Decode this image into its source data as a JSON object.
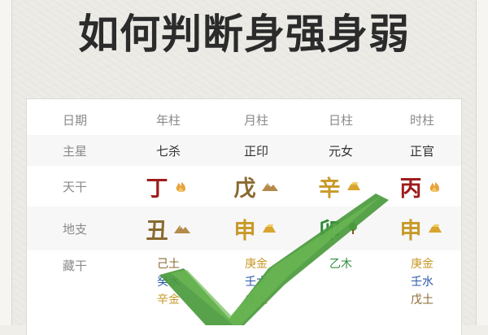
{
  "title": "如何判断身强身弱",
  "table": {
    "header": {
      "label": "日期",
      "cols": [
        "年柱",
        "月柱",
        "日柱",
        "时柱"
      ]
    },
    "main_star": {
      "label": "主星",
      "cols": [
        "七杀",
        "正印",
        "元女",
        "正官"
      ]
    },
    "heavenly_stems": {
      "label": "天干",
      "cols": [
        {
          "char": "丁",
          "color": "#9e1c1c",
          "icon": "fire-icon"
        },
        {
          "char": "戊",
          "color": "#8a6a2f",
          "icon": "mountain-icon"
        },
        {
          "char": "辛",
          "color": "#c89a2a",
          "icon": "gold-icon"
        },
        {
          "char": "丙",
          "color": "#9e1c1c",
          "icon": "fire-icon"
        }
      ]
    },
    "earthly_branches": {
      "label": "地支",
      "cols": [
        {
          "char": "丑",
          "color": "#8a6a2f",
          "icon": "mountain-icon"
        },
        {
          "char": "申",
          "color": "#c89a2a",
          "icon": "gold-icon"
        },
        {
          "char": "卯",
          "color": "#2e8b3a",
          "icon": "tree-icon"
        },
        {
          "char": "申",
          "color": "#c89a2a",
          "icon": "gold-icon"
        }
      ]
    },
    "hidden_stems": {
      "label": "藏干",
      "cols": [
        [
          {
            "text": "己土",
            "color": "#8a6a2f"
          },
          {
            "text": "癸水",
            "color": "#2b5aa8"
          },
          {
            "text": "辛金",
            "color": "#c89a2a"
          }
        ],
        [
          {
            "text": "庚金",
            "color": "#c89a2a"
          },
          {
            "text": "壬水",
            "color": "#2b5aa8"
          },
          {
            "text": "戊土",
            "color": "#8a6a2f"
          }
        ],
        [
          {
            "text": "乙木",
            "color": "#2e8b3a"
          }
        ],
        [
          {
            "text": "庚金",
            "color": "#c89a2a"
          },
          {
            "text": "壬水",
            "color": "#2b5aa8"
          },
          {
            "text": "戊土",
            "color": "#8a6a2f"
          }
        ]
      ]
    }
  },
  "colors": {
    "check_mark": "#4a9a3c",
    "check_mark_light": "#6dbb55"
  }
}
